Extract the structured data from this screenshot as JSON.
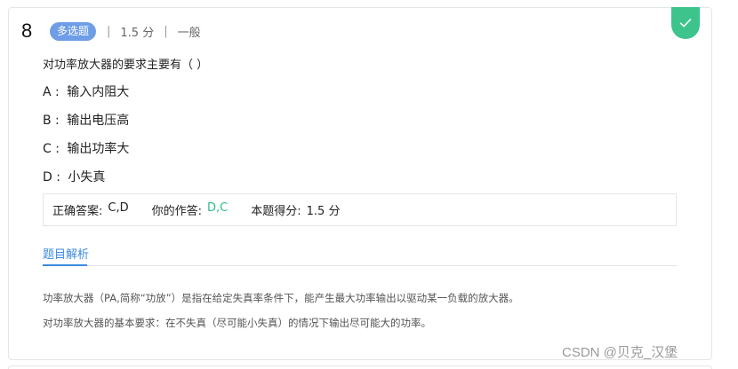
{
  "question": {
    "number": "8",
    "type": "多选题",
    "score": "1.5 分",
    "difficulty": "一般",
    "separator": "|",
    "stem": "对功率放大器的要求主要有（ ）",
    "options": [
      {
        "letter": "A :",
        "text": "输入内阻大"
      },
      {
        "letter": "B :",
        "text": "输出电压高"
      },
      {
        "letter": "C :",
        "text": "输出功率大"
      },
      {
        "letter": "D :",
        "text": "小失真"
      }
    ]
  },
  "result": {
    "correct_label": "正确答案:",
    "correct_value": "C,D",
    "your_label": "你的作答:",
    "your_value": "D,C",
    "score_label": "本题得分:",
    "score_value": "1.5 分",
    "status_icon": "check-icon",
    "status_color": "#3cc48c"
  },
  "analysis": {
    "tab_label": "题目解析",
    "lines": [
      "功率放大器（PA,简称“功放”）是指在给定失真率条件下，能产生最大功率输出以驱动某一负载的放大器。",
      "对功率放大器的基本要求：在不失真（尽可能小失真）的情况下输出尽可能大的功率。"
    ]
  },
  "watermark": "CSDN @贝克_汉堡",
  "colors": {
    "badge": "#6f9ee6",
    "accent": "#3c8ae0",
    "correct": "#2fbf88"
  }
}
